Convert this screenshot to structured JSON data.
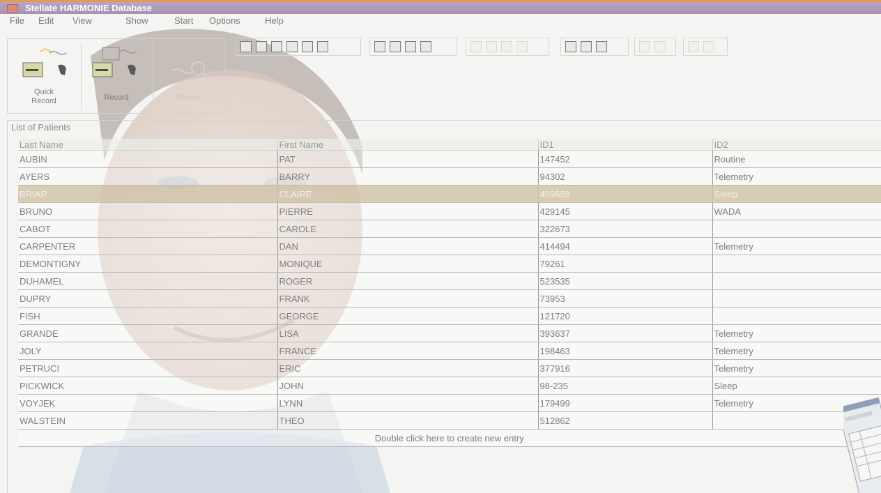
{
  "window": {
    "title": "Stellate HARMONIE Database"
  },
  "menu": [
    "File",
    "Edit",
    "View",
    "Show",
    "Start",
    "Options",
    "Help"
  ],
  "big_buttons": [
    {
      "label": "Quick\nRecord",
      "icon": "quick-record-icon",
      "enabled": true
    },
    {
      "label": "Record",
      "icon": "record-icon",
      "enabled": true
    },
    {
      "label": "Review",
      "icon": "review-icon",
      "enabled": false
    }
  ],
  "panel": {
    "title": "List of Patients"
  },
  "table": {
    "columns": [
      "Last Name",
      "First Name",
      "ID1",
      "ID2"
    ],
    "rows": [
      [
        "AUBIN",
        "PAT",
        "147452",
        "Routine"
      ],
      [
        "AYERS",
        "BARRY",
        "94302",
        "Telemetry"
      ],
      [
        "BRIAR",
        "CLAIRE",
        "409659",
        "Sleep"
      ],
      [
        "BRUNO",
        "PIERRE",
        "429145",
        "WADA"
      ],
      [
        "CABOT",
        "CAROLE",
        "322673",
        ""
      ],
      [
        "CARPENTER",
        "DAN",
        "414494",
        "Telemetry"
      ],
      [
        "DEMONTIGNY",
        "MONIQUE",
        "79261",
        ""
      ],
      [
        "DUHAMEL",
        "ROGER",
        "523535",
        ""
      ],
      [
        "DUPRY",
        "FRANK",
        "73953",
        ""
      ],
      [
        "FISH",
        "GEORGE",
        "121720",
        ""
      ],
      [
        "GRANDE",
        "LISA",
        "393637",
        "Telemetry"
      ],
      [
        "JOLY",
        "FRANCE",
        "198463",
        "Telemetry"
      ],
      [
        "PETRUCI",
        "ERIC",
        "377916",
        "Telemetry"
      ],
      [
        "PICKWICK",
        "JOHN",
        "98-235",
        "Sleep"
      ],
      [
        "VOYJEK",
        "LYNN",
        "179499",
        "Telemetry"
      ],
      [
        "WALSTEIN",
        "THEO",
        "512862",
        ""
      ]
    ],
    "selected_row": 2,
    "new_entry_text": "Double click here to create new entry"
  }
}
